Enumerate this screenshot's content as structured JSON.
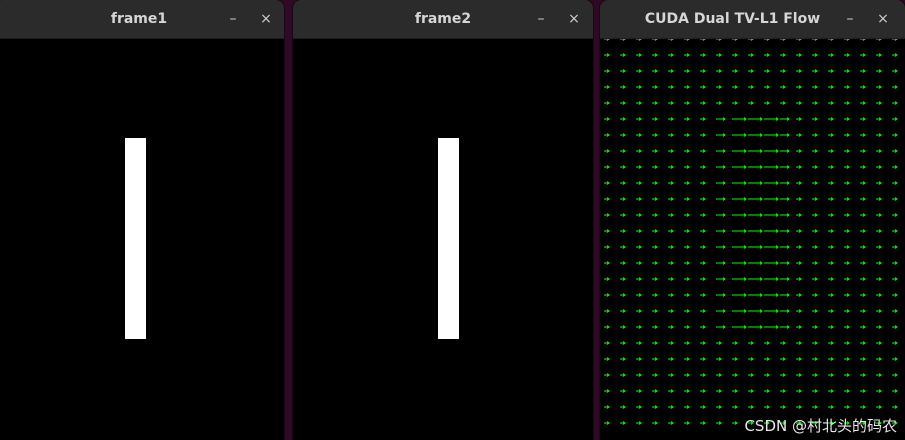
{
  "windows": [
    {
      "title": "frame1",
      "minimize_glyph": "–",
      "close_glyph": "×"
    },
    {
      "title": "frame2",
      "minimize_glyph": "–",
      "close_glyph": "×"
    },
    {
      "title": "CUDA Dual TV-L1 Flow",
      "minimize_glyph": "–",
      "close_glyph": "×"
    }
  ],
  "icons": {
    "minimize": "minimize-icon",
    "close": "close-icon"
  },
  "colors": {
    "flow_arrow": "#00ff00",
    "bar": "#ffffff",
    "titlebar": "#2b2b2b",
    "desktop": "#300a24"
  },
  "watermark": "CSDN @村北头的码农"
}
